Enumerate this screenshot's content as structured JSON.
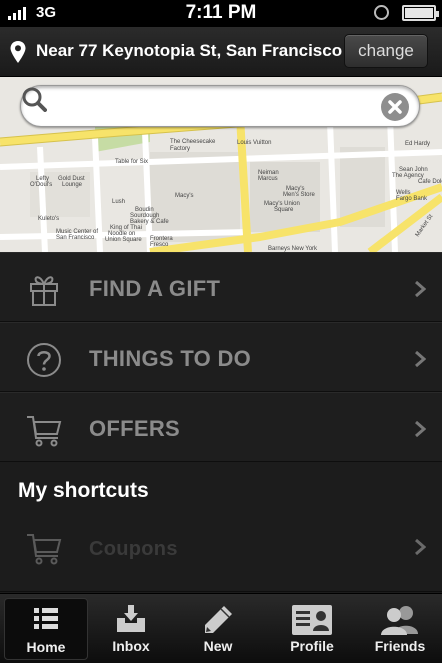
{
  "status_bar": {
    "network": "3G",
    "time": "7:11 PM"
  },
  "location": {
    "text": "Near 77 Keynotopia St, San Francisco",
    "change_label": "change"
  },
  "search": {
    "placeholder": "",
    "value": ""
  },
  "map": {
    "labels": [
      "The Cheesecake Factory",
      "Louis Vuitton",
      "Ed Hardy",
      "Table for Six",
      "Lefty O'Doul's",
      "Gold Dust Lounge",
      "Macy's",
      "Neiman Marcus",
      "Macy's Men's Store",
      "Sean John",
      "The Agency",
      "Cafe Dolci",
      "Wells Fargo Bank",
      "Kuleto's",
      "Lush",
      "Boudin Sourdough Bakery & Cafe",
      "Macy's Union Square",
      "Music Center of San Francisco",
      "King of Thai Noodle on Union Square",
      "Frontera Fresco",
      "Barneys New York",
      "Market St"
    ]
  },
  "menu": [
    {
      "label": "FIND A GIFT",
      "icon": "gift-icon"
    },
    {
      "label": "THINGS TO DO",
      "icon": "question-icon"
    },
    {
      "label": "OFFERS",
      "icon": "cart-icon"
    }
  ],
  "shortcuts": {
    "header": "My shortcuts",
    "items": [
      {
        "label": "Coupons",
        "icon": "cart-icon"
      }
    ]
  },
  "tabs": [
    {
      "label": "Home",
      "icon": "list-icon",
      "active": true
    },
    {
      "label": "Inbox",
      "icon": "inbox-icon",
      "active": false
    },
    {
      "label": "New",
      "icon": "pencil-icon",
      "active": false
    },
    {
      "label": "Profile",
      "icon": "id-card-icon",
      "active": false
    },
    {
      "label": "Friends",
      "icon": "friends-icon",
      "active": false
    }
  ],
  "colors": {
    "menu_text": "#8b8b8b",
    "shortcut_text": "#3a3a3a",
    "map_road": "#f7e36a"
  }
}
